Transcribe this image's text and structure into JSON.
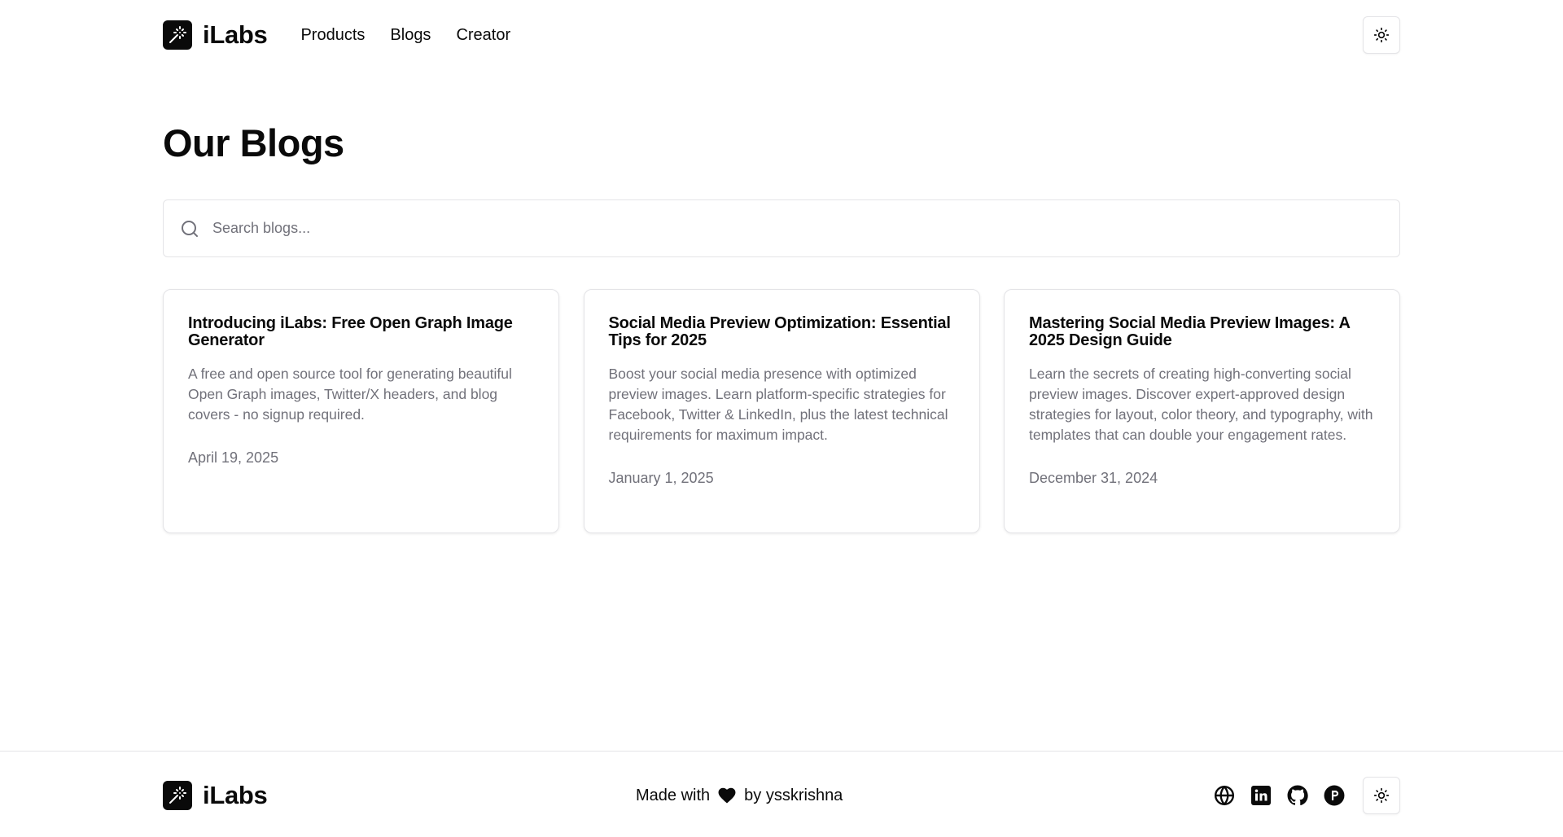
{
  "header": {
    "brand": "iLabs",
    "nav": [
      "Products",
      "Blogs",
      "Creator"
    ],
    "theme_icon": "sun-icon"
  },
  "main": {
    "title": "Our Blogs",
    "search": {
      "placeholder": "Search blogs...",
      "value": ""
    },
    "posts": [
      {
        "title": "Introducing iLabs: Free Open Graph Image Generator",
        "description": "A free and open source tool for generating beautiful Open Graph images, Twitter/X headers, and blog covers - no signup required.",
        "date": "April 19, 2025"
      },
      {
        "title": "Social Media Preview Optimization: Essential Tips for 2025",
        "description": "Boost your social media presence with optimized preview images. Learn platform-specific strategies for Facebook, Twitter & LinkedIn, plus the latest technical requirements for maximum impact.",
        "date": "January 1, 2025"
      },
      {
        "title": "Mastering Social Media Preview Images: A 2025 Design Guide",
        "description": "Learn the secrets of creating high-converting social preview images. Discover expert-approved design strategies for layout, color theory, and typography, with templates that can double your engagement rates.",
        "date": "December 31, 2024"
      }
    ]
  },
  "footer": {
    "brand": "iLabs",
    "made_with": "Made with",
    "by": "by ysskrishna",
    "social_icons": [
      "globe-icon",
      "linkedin-icon",
      "github-icon",
      "product-hunt-icon"
    ]
  },
  "colors": {
    "primary": "#0a0a0a",
    "muted": "#71717a",
    "border": "#e4e4e7"
  }
}
